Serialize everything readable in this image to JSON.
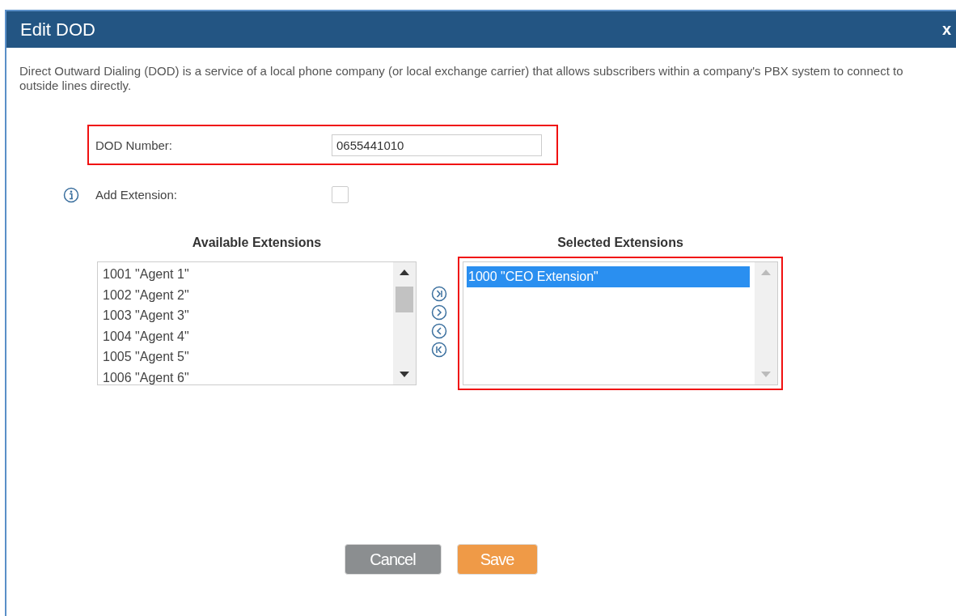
{
  "window": {
    "title": "Edit DOD",
    "close": "x"
  },
  "description": "Direct Outward Dialing (DOD) is a service of a local phone company (or local exchange carrier) that allows subscribers within a company's PBX system to connect to outside lines directly.",
  "dod_number": {
    "label": "DOD Number:",
    "value": "0655441010",
    "highlighted": true
  },
  "add_extension": {
    "label": "Add Extension:",
    "checked": false
  },
  "available": {
    "heading": "Available Extensions",
    "items": [
      {
        "label": "1001 \"Agent 1\"",
        "selected": false
      },
      {
        "label": "1002 \"Agent 2\"",
        "selected": false
      },
      {
        "label": "1003 \"Agent 3\"",
        "selected": false
      },
      {
        "label": "1004 \"Agent 4\"",
        "selected": false
      },
      {
        "label": "1005 \"Agent 5\"",
        "selected": false
      },
      {
        "label": "1006 \"Agent 6\"",
        "selected": false
      }
    ],
    "highlighted": false
  },
  "selected": {
    "heading": "Selected Extensions",
    "items": [
      {
        "label": "1000 \"CEO Extension\"",
        "selected": true
      }
    ],
    "highlighted": true
  },
  "buttons": [
    {
      "label": "Cancel",
      "kind": "secondary"
    },
    {
      "label": "Save",
      "kind": "primary"
    }
  ]
}
